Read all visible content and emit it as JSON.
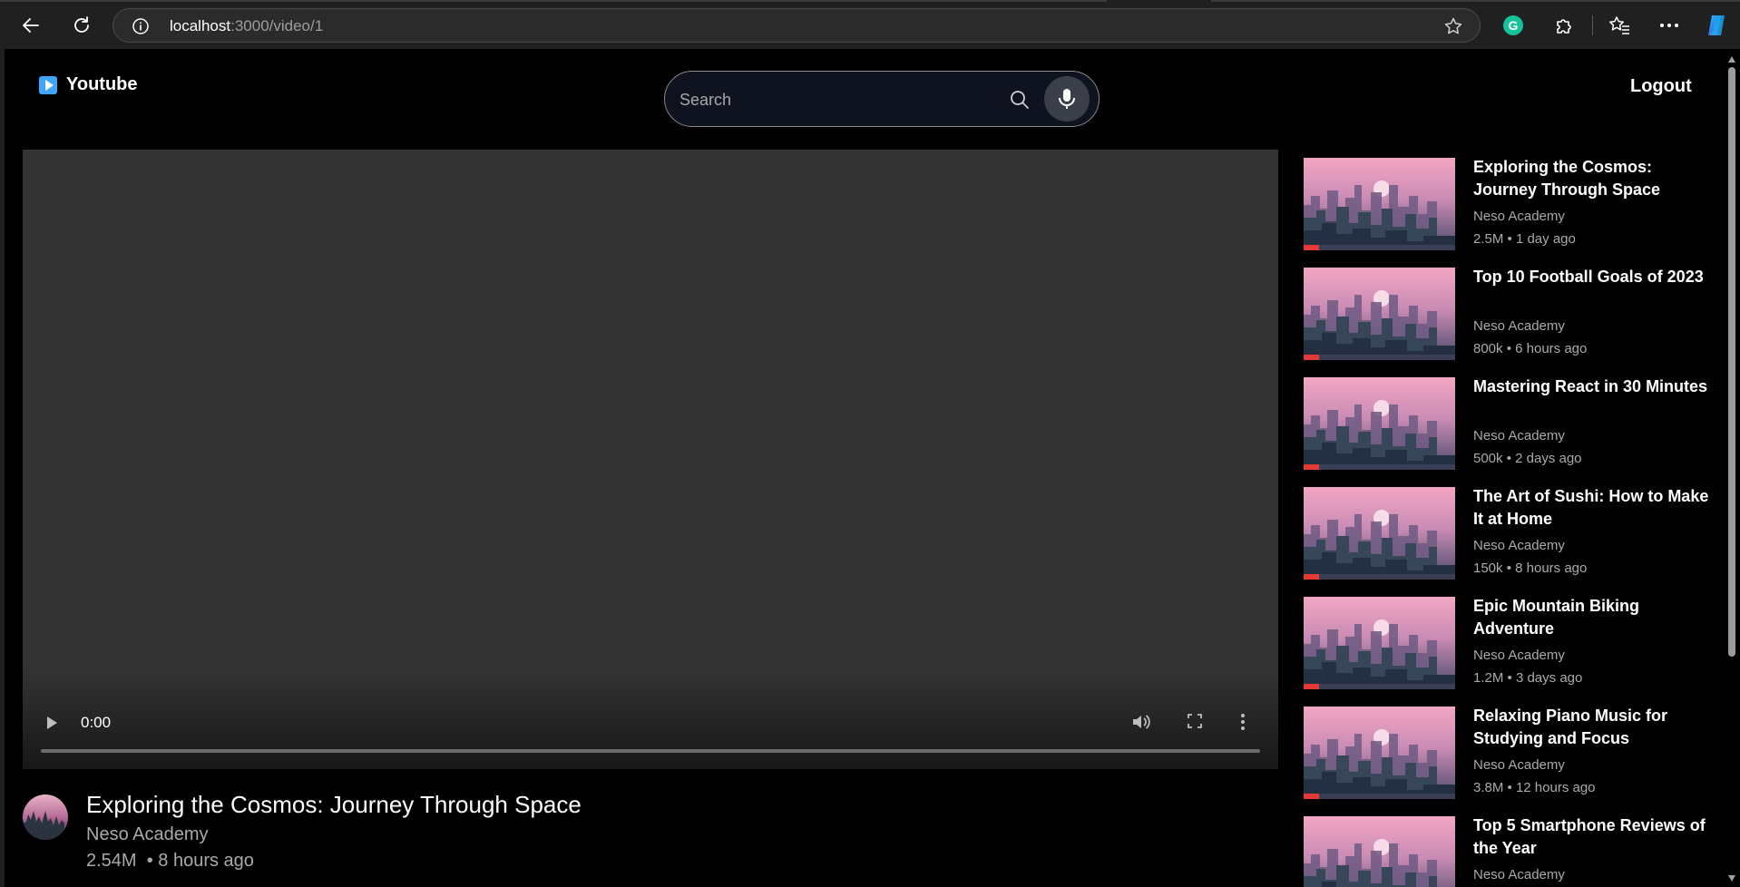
{
  "browser": {
    "url_host": "localhost",
    "url_path": ":3000/video/1"
  },
  "header": {
    "logo_text": "Youtube",
    "search_placeholder": "Search",
    "logout_label": "Logout"
  },
  "player": {
    "current_time": "0:00",
    "progress": 0
  },
  "video": {
    "title": "Exploring the Cosmos: Journey Through Space",
    "channel": "Neso Academy",
    "views": "2.54M",
    "age": "8 hours ago"
  },
  "recommendations": [
    {
      "title": "Exploring the Cosmos: Journey Through Space",
      "channel": "Neso Academy",
      "views": "2.5M",
      "age": "1 day ago",
      "watched": 0.1
    },
    {
      "title": "Top 10 Football Goals of 2023",
      "channel": "Neso Academy",
      "views": "800k",
      "age": "6 hours ago",
      "watched": 0.1
    },
    {
      "title": "Mastering React in 30 Minutes",
      "channel": "Neso Academy",
      "views": "500k",
      "age": "2 days ago",
      "watched": 0.1
    },
    {
      "title": "The Art of Sushi: How to Make It at Home",
      "channel": "Neso Academy",
      "views": "150k",
      "age": "8 hours ago",
      "watched": 0.1
    },
    {
      "title": "Epic Mountain Biking Adventure",
      "channel": "Neso Academy",
      "views": "1.2M",
      "age": "3 days ago",
      "watched": 0.1
    },
    {
      "title": "Relaxing Piano Music for Studying and Focus",
      "channel": "Neso Academy",
      "views": "3.8M",
      "age": "12 hours ago",
      "watched": 0.1
    },
    {
      "title": "Top 5 Smartphone Reviews of the Year",
      "channel": "Neso Academy",
      "views": "",
      "age": "",
      "watched": 0.1
    }
  ],
  "colors": {
    "accent": "#3ea6ff",
    "progress_red": "#e53935"
  }
}
